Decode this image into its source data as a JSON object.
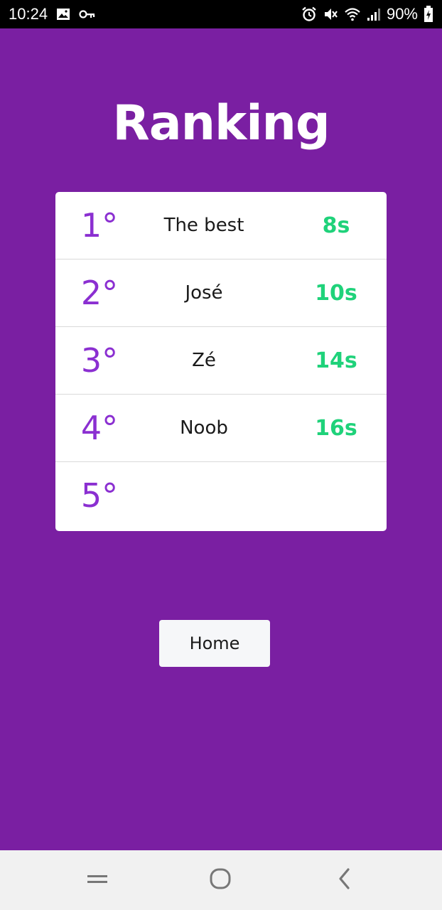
{
  "status_bar": {
    "time": "10:24",
    "battery": "90%",
    "icons": [
      "image-icon",
      "key-icon",
      "alarm-icon",
      "mute-icon",
      "wifi-icon",
      "signal-icon",
      "battery-charging-icon"
    ]
  },
  "page": {
    "title": "Ranking"
  },
  "ranking": [
    {
      "position": "1°",
      "name": "The best",
      "time": "8s"
    },
    {
      "position": "2°",
      "name": "José",
      "time": "10s"
    },
    {
      "position": "3°",
      "name": "Zé",
      "time": "14s"
    },
    {
      "position": "4°",
      "name": "Noob",
      "time": "16s"
    },
    {
      "position": "5°",
      "name": "",
      "time": ""
    }
  ],
  "actions": {
    "home_label": "Home"
  },
  "nav_bar": {
    "icons": [
      "recent-apps-icon",
      "home-icon",
      "back-icon"
    ]
  },
  "colors": {
    "background": "#7a1fa2",
    "position_text": "#8b2fd1",
    "time_text": "#1fd27a",
    "card": "#ffffff"
  }
}
